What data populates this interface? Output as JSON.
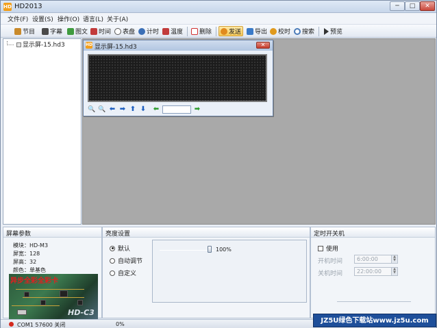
{
  "app": {
    "title": "HD2013",
    "icon": "hd-app-icon"
  },
  "window_controls": {
    "minimize": "─",
    "maximize": "□",
    "close": "✕"
  },
  "menu": [
    "文件(F)",
    "设置(S)",
    "操作(O)",
    "语言(L)",
    "关于(A)"
  ],
  "toolbar": [
    {
      "label": "节目",
      "icon": "program-icon",
      "color": "#c98a2b"
    },
    {
      "label": "字幕",
      "icon": "subtitle-icon",
      "color": "#4a4a4a"
    },
    {
      "label": "图文",
      "icon": "image-text-icon",
      "color": "#3f9b3f"
    },
    {
      "label": "时间",
      "icon": "time-icon",
      "color": "#c23b3b"
    },
    {
      "label": "表盘",
      "icon": "clock-dial-icon",
      "color": "#555555"
    },
    {
      "label": "计时",
      "icon": "timer-icon",
      "color": "#3b6fb6"
    },
    {
      "label": "温度",
      "icon": "temperature-icon",
      "color": "#c23b3b"
    },
    {
      "label": "删除",
      "icon": "delete-icon",
      "color": "#d03030"
    },
    {
      "label": "发送",
      "icon": "send-icon",
      "color": "#e08a1e"
    },
    {
      "label": "导出",
      "icon": "export-icon",
      "color": "#3a7ac8"
    },
    {
      "label": "校时",
      "icon": "time-sync-icon",
      "color": "#e09a1e"
    },
    {
      "label": "搜索",
      "icon": "search-icon",
      "color": "#4a7ab8"
    },
    {
      "label": "预览",
      "icon": "preview-icon",
      "color": "#333333"
    }
  ],
  "tree": {
    "node": "显示屏-15.hd3"
  },
  "document": {
    "title": "显示屏-15.hd3",
    "close": "✕",
    "tools": [
      {
        "icon": "zoom-in-icon",
        "glyph": "🔍"
      },
      {
        "icon": "zoom-out-icon",
        "glyph": "🔍"
      },
      {
        "icon": "arrow-left-icon",
        "glyph": "⬅"
      },
      {
        "icon": "arrow-right-icon",
        "glyph": "➡"
      },
      {
        "icon": "arrow-up-icon",
        "glyph": "⬆"
      },
      {
        "icon": "arrow-down-icon",
        "glyph": "⬇"
      }
    ],
    "nav_prev_glyph": "⬅",
    "nav_next_glyph": "➡"
  },
  "screen_params": {
    "title": "屏幕参数",
    "lines": [
      "模块：HD-M3",
      "屏宽：128",
      "屏高：32",
      "颜色：单基色"
    ],
    "promo_text": "异步全彩全彩卡",
    "promo_model": "HD-C3"
  },
  "brightness": {
    "title": "亮度设置",
    "options": [
      {
        "label": "默认",
        "selected": true
      },
      {
        "label": "自动调节",
        "selected": false
      },
      {
        "label": "自定义",
        "selected": false
      }
    ],
    "value": "100%",
    "level": 1.0
  },
  "timer_power": {
    "title": "定时开关机",
    "use_label": "使用",
    "use_checked": false,
    "on_label": "开机时间",
    "on_value": "6:00:00",
    "off_label": "关机时间",
    "off_value": "22:00:00"
  },
  "status": {
    "port": "COM1  57600  关闭",
    "progress": "0%"
  },
  "watermark": "JZ5U绿色下载站www.jz5u.com"
}
